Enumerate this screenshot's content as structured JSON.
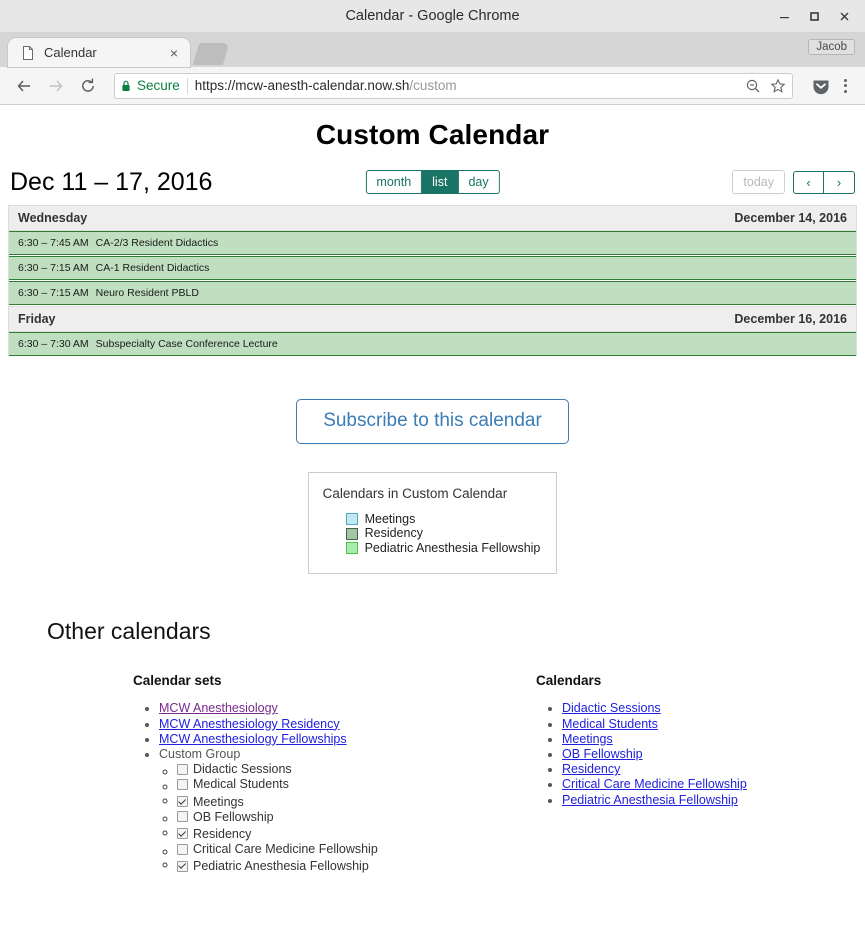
{
  "browser": {
    "window_title": "Calendar - Google Chrome",
    "minimize_label": "Minimize",
    "maximize_label": "Maximize",
    "close_label": "Close",
    "tab": {
      "title": "Calendar",
      "close_label": "×"
    },
    "new_tab_label": "New tab",
    "profile_label": "Jacob",
    "back_label": "Back",
    "forward_label": "Forward",
    "reload_label": "Reload",
    "security_label": "Secure",
    "url_host": "https://mcw-anesth-calendar.now.sh",
    "url_path": "/custom",
    "zoom_out_label": "Zoom out",
    "bookmark_label": "Bookmark this page",
    "pocket_label": "Save to Pocket",
    "menu_label": "Customize and control Google Chrome"
  },
  "page": {
    "title": "Custom Calendar",
    "date_range": "Dec 11 – 17, 2016",
    "views": [
      {
        "id": "month",
        "label": "month",
        "active": false
      },
      {
        "id": "list",
        "label": "list",
        "active": true
      },
      {
        "id": "day",
        "label": "day",
        "active": false
      }
    ],
    "today_label": "today",
    "prev_label": "‹",
    "next_label": "›",
    "subscribe_label": "Subscribe to this calendar"
  },
  "calendar": {
    "days": [
      {
        "weekday": "Wednesday",
        "date": "December 14, 2016",
        "events": [
          {
            "time": "6:30 – 7:45 AM",
            "title": "CA-2/3 Resident Didactics"
          },
          {
            "time": "6:30 – 7:15 AM",
            "title": "CA-1 Resident Didactics"
          },
          {
            "time": "6:30 – 7:15 AM",
            "title": "Neuro Resident PBLD"
          }
        ]
      },
      {
        "weekday": "Friday",
        "date": "December 16, 2016",
        "events": [
          {
            "time": "6:30 – 7:30 AM",
            "title": "Subspecialty Case Conference Lecture"
          }
        ]
      }
    ],
    "event_fill": "#bfdfc0",
    "event_border": "#2e7d32"
  },
  "legend": {
    "title": "Calendars in Custom Calendar",
    "items": [
      {
        "label": "Meetings",
        "fill": "#bfe8f2",
        "border": "#55a8bd"
      },
      {
        "label": "Residency",
        "fill": "#a8c3a8",
        "border": "#3c6b3c"
      },
      {
        "label": "Pediatric Anesthesia Fellowship",
        "fill": "#a8ecab",
        "border": "#4cbf55"
      }
    ]
  },
  "other_calendars": {
    "heading": "Other calendars",
    "calendar_sets": {
      "heading": "Calendar sets",
      "links": [
        {
          "label": "MCW Anesthesiology",
          "visited": true
        },
        {
          "label": "MCW Anesthesiology Residency",
          "visited": false
        },
        {
          "label": "MCW Anesthesiology Fellowships",
          "visited": false
        }
      ],
      "custom_group_label": "Custom Group",
      "custom_group_items": [
        {
          "label": "Didactic Sessions",
          "checked": false
        },
        {
          "label": "Medical Students",
          "checked": false
        },
        {
          "label": "Meetings",
          "checked": true
        },
        {
          "label": "OB Fellowship",
          "checked": false
        },
        {
          "label": "Residency",
          "checked": true
        },
        {
          "label": "Critical Care Medicine Fellowship",
          "checked": false
        },
        {
          "label": "Pediatric Anesthesia Fellowship",
          "checked": true
        }
      ]
    },
    "calendars": {
      "heading": "Calendars",
      "links": [
        "Didactic Sessions",
        "Medical Students",
        "Meetings",
        "OB Fellowship",
        "Residency",
        "Critical Care Medicine Fellowship",
        "Pediatric Anesthesia Fellowship"
      ]
    }
  },
  "colors": {
    "accent_teal": "#1a7466",
    "link_blue": "#2121dd",
    "link_visited": "#7a2a8e",
    "subscribe_blue": "#3a7cb5",
    "secure_green": "#0b8043"
  }
}
